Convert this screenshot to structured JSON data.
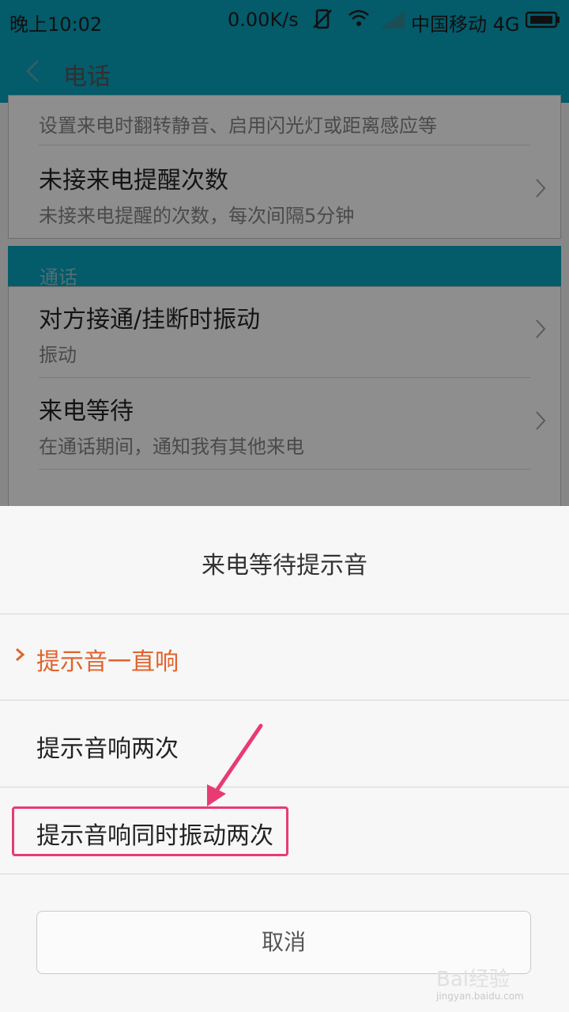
{
  "status_bar": {
    "time": "晚上10:02",
    "net_speed": "0.00K/s",
    "carrier": "中国移动 4G"
  },
  "app_bar": {
    "title": "电话"
  },
  "settings": {
    "rows_top": [
      {
        "subtitle": "设置来电时翻转静音、启用闪光灯或距离感应等"
      },
      {
        "title": "未接来电提醒次数",
        "subtitle": "未接来电提醒的次数，每次间隔5分钟"
      }
    ],
    "section_header": "通话",
    "rows_call": [
      {
        "title": "对方接通/挂断时振动",
        "subtitle": "振动"
      },
      {
        "title": "来电等待",
        "subtitle": "在通话期间，通知我有其他来电"
      }
    ]
  },
  "dialog": {
    "title": "来电等待提示音",
    "options": [
      {
        "label": "提示音一直响",
        "selected": true
      },
      {
        "label": "提示音响两次",
        "selected": false
      },
      {
        "label": "提示音响同时振动两次",
        "selected": false
      }
    ],
    "cancel_label": "取消"
  },
  "watermark": {
    "brand": "Bai经验",
    "url": "jingyan.baidu.com"
  },
  "colors": {
    "accent": "#e2622b",
    "app_bar": "#045b6a",
    "annotation": "#e83b73"
  }
}
